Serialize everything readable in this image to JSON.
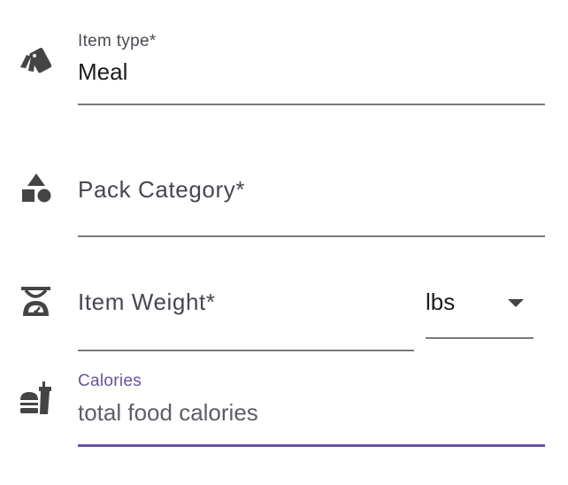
{
  "fields": {
    "item_type": {
      "label": "Item type*",
      "value": "Meal",
      "icon": "tag-icon"
    },
    "pack_category": {
      "label": "Pack Category*",
      "value": "",
      "icon": "category-shapes-icon"
    },
    "item_weight": {
      "label": "Item Weight*",
      "value": "",
      "icon": "scale-icon",
      "unit": {
        "selected": "lbs",
        "icon": "caret-down-icon"
      }
    },
    "calories": {
      "label": "Calories",
      "placeholder": "total food calories",
      "value": "",
      "icon": "fastfood-icon"
    }
  },
  "colors": {
    "accent": "#6750a4",
    "icon": "#444444",
    "text": "#1c1b1f",
    "underline": "#7a7a7a"
  }
}
